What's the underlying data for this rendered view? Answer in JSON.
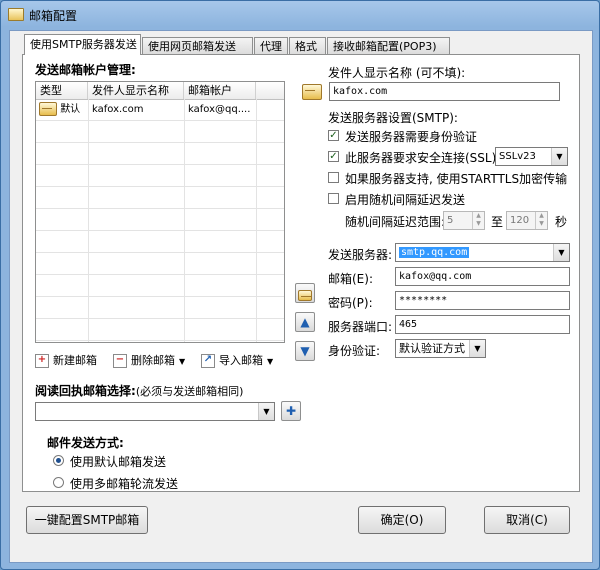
{
  "window": {
    "title": "邮箱配置"
  },
  "tabs": [
    {
      "label": "使用SMTP服务器发送"
    },
    {
      "label": "使用网页邮箱发送"
    },
    {
      "label": "代理"
    },
    {
      "label": "格式"
    },
    {
      "label": "接收邮箱配置(POP3)"
    }
  ],
  "account_section": {
    "title": "发送邮箱帐户管理:",
    "columns": [
      "类型",
      "发件人显示名称",
      "邮箱帐户"
    ],
    "rows": [
      {
        "type": "默认",
        "display_name": "kafox.com",
        "account": "kafox@qq...."
      }
    ],
    "toolbar": {
      "new": "新建邮箱",
      "delete": "删除邮箱",
      "import": "导入邮箱"
    }
  },
  "receipt": {
    "label": "阅读回执邮箱选择:",
    "note": "(必须与发送邮箱相同)",
    "value": ""
  },
  "send_mode": {
    "title": "邮件发送方式:",
    "options": [
      {
        "label": "使用默认邮箱发送",
        "selected": true
      },
      {
        "label": "使用多邮箱轮流发送",
        "selected": false
      }
    ]
  },
  "sender": {
    "label": "发件人显示名称 (可不填):",
    "value": "kafox.com"
  },
  "smtp": {
    "section_label": "发送服务器设置(SMTP):",
    "auth_required": {
      "label": "发送服务器需要身份验证",
      "checked": true
    },
    "secure": {
      "label": "此服务器要求安全连接(SSL)",
      "checked": true,
      "protocol": "SSLv23"
    },
    "starttls": {
      "label": "如果服务器支持, 使用STARTTLS加密传输",
      "checked": false
    },
    "random_delay": {
      "label": "启用随机间隔延迟发送",
      "checked": false
    },
    "delay_range": {
      "label": "随机间隔延迟范围:",
      "from": "5",
      "to_label": "至",
      "to": "120",
      "unit": "秒"
    }
  },
  "server_fields": {
    "server_label": "发送服务器:",
    "server_value": "smtp.qq.com",
    "email_label": "邮箱(E):",
    "email_value": "kafox@qq.com",
    "password_label": "密码(P):",
    "password_value": "********",
    "port_label": "服务器端口:",
    "port_value": "465",
    "auth_label": "身份验证:",
    "auth_value": "默认验证方式"
  },
  "buttons": {
    "one_click": "一键配置SMTP邮箱",
    "ok": "确定(O)",
    "cancel": "取消(C)"
  }
}
